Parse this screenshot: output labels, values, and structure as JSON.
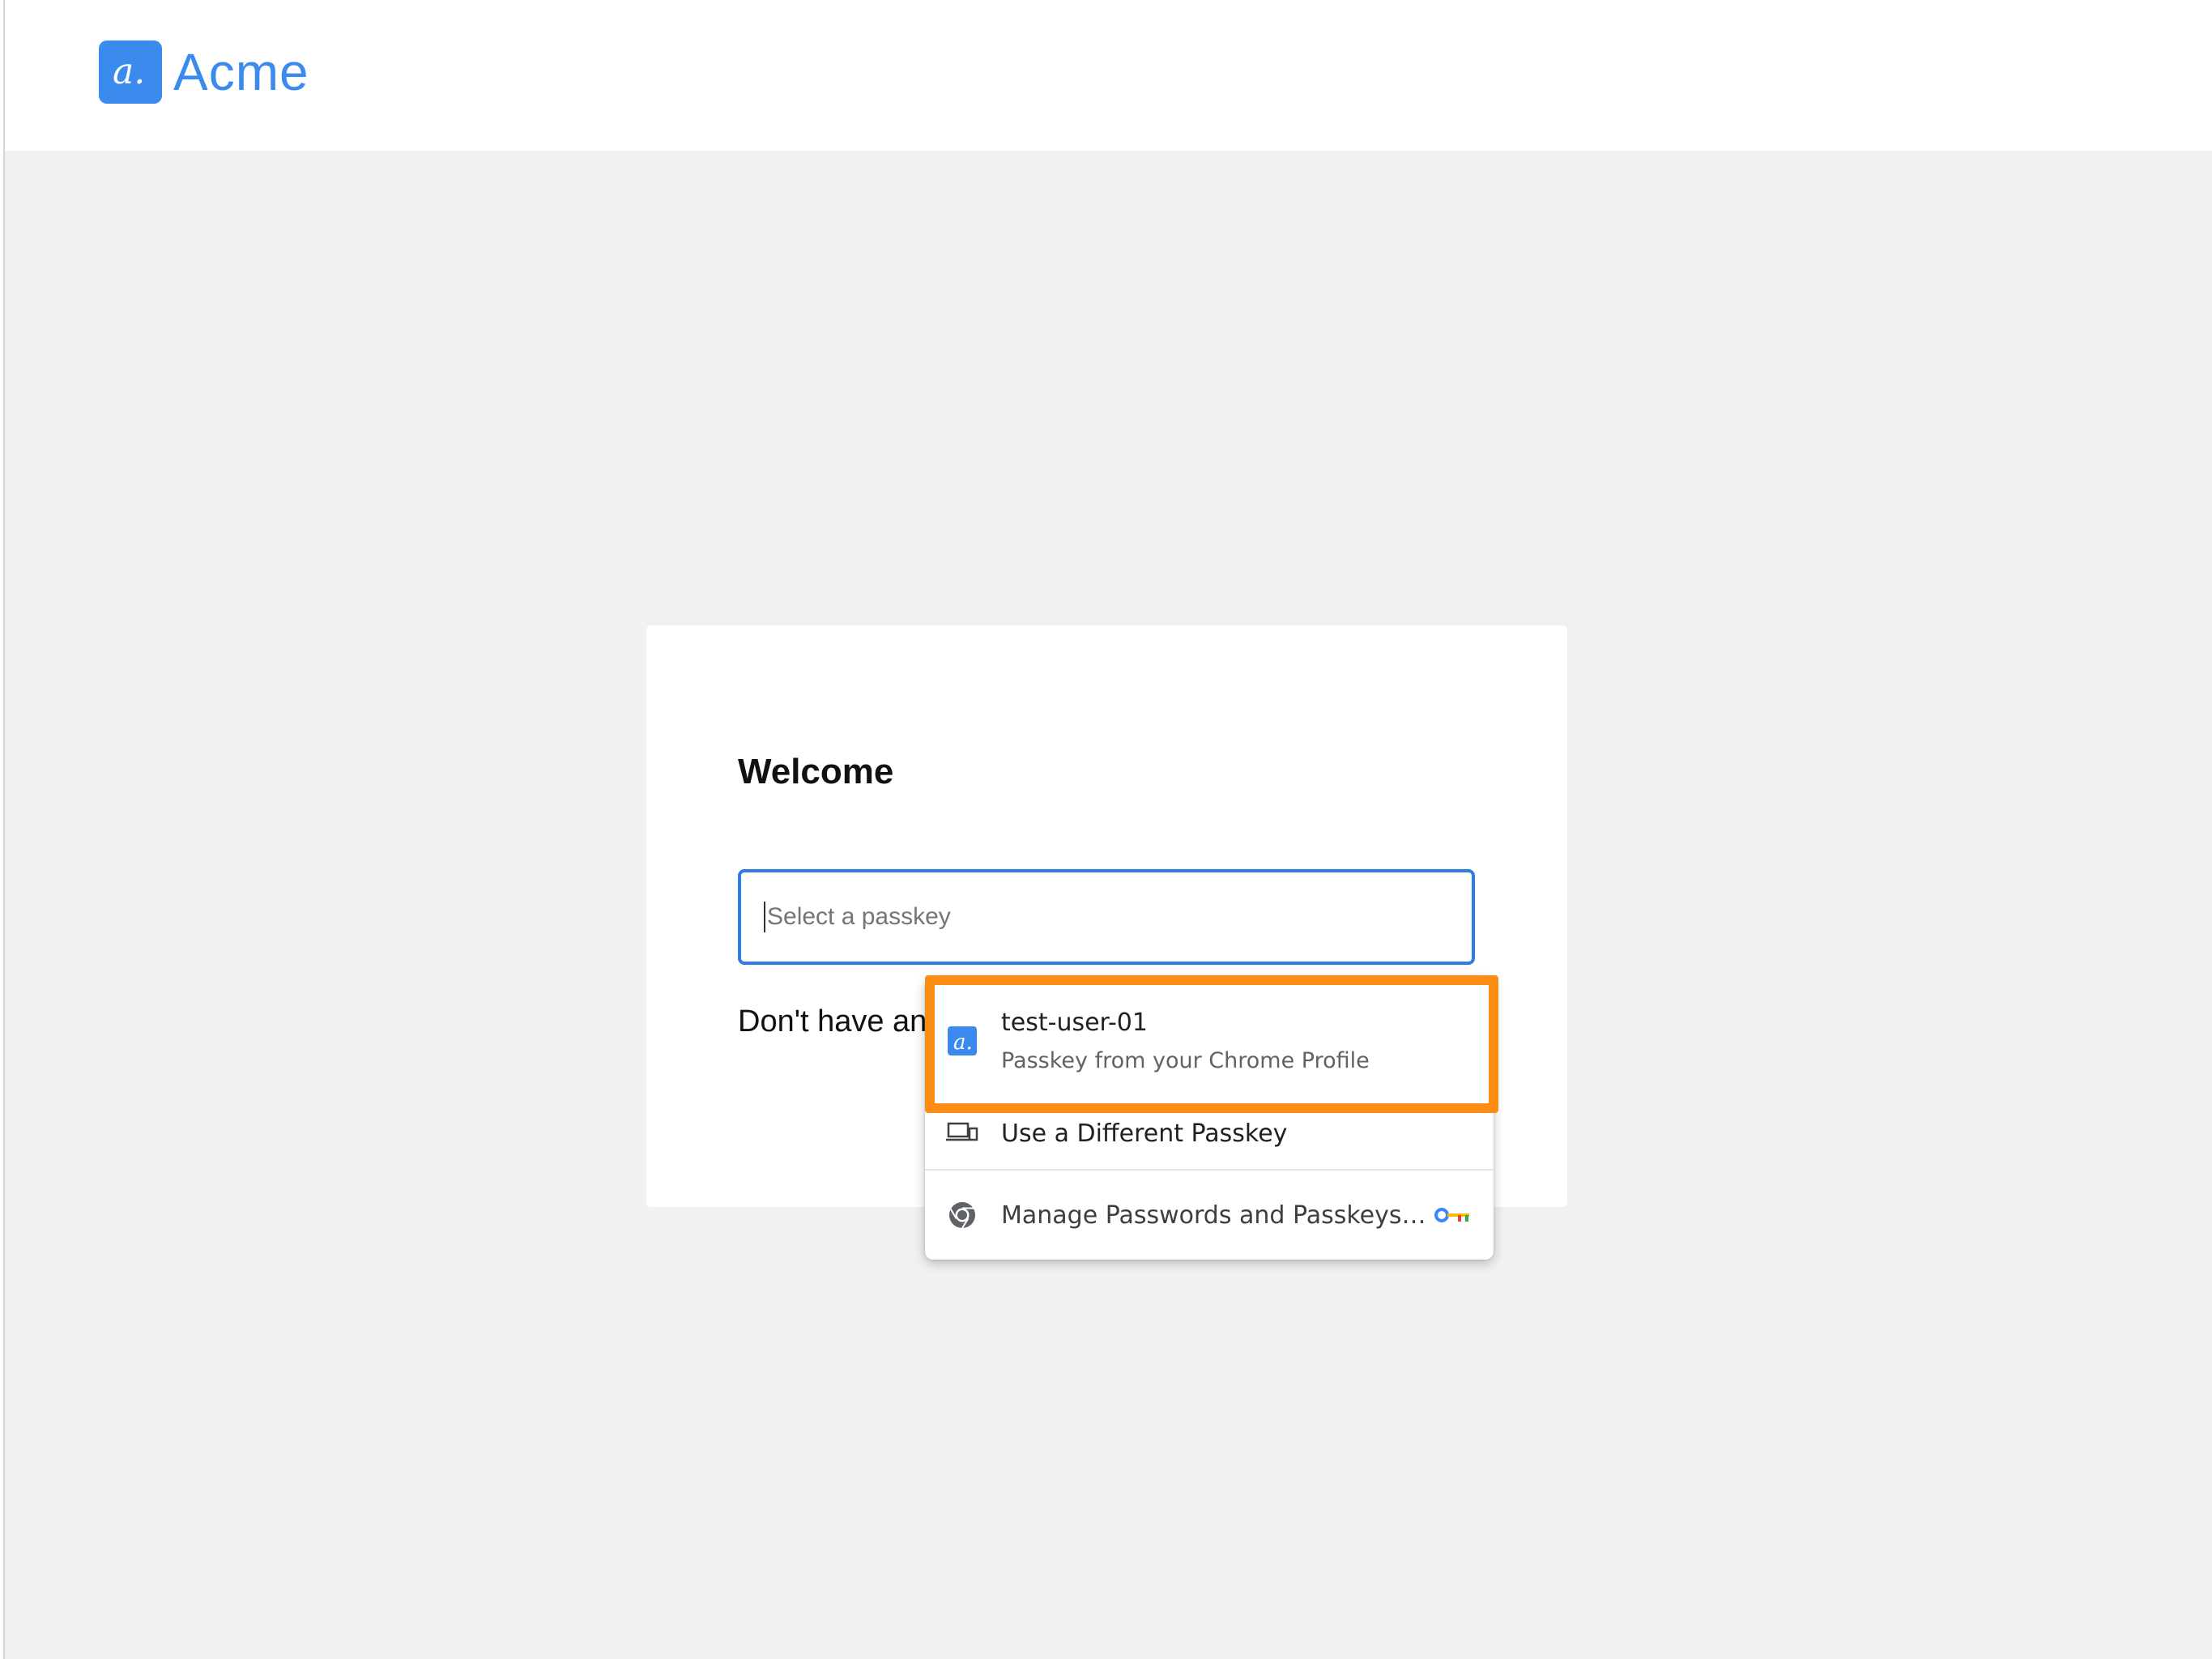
{
  "header": {
    "logo_mark": "a.",
    "brand_name": "Acme"
  },
  "login": {
    "title": "Welcome",
    "input_placeholder": "Select a passkey",
    "signup_prompt": "Don't have an"
  },
  "passkey_dropdown": {
    "items": [
      {
        "icon": "acme-logo-icon",
        "title": "test-user-01",
        "subtitle": "Passkey from your Chrome Profile"
      },
      {
        "icon": "devices-icon",
        "title": "Use a Different Passkey"
      },
      {
        "icon": "chrome-icon",
        "title": "Manage Passwords and Passkeys…",
        "trailing_icon": "password-key-icon"
      }
    ]
  },
  "colors": {
    "brand_blue": "#3b8bef",
    "focus_blue": "#2d7be5",
    "highlight_orange": "#fb8c15",
    "background": "#f1f1f1"
  }
}
